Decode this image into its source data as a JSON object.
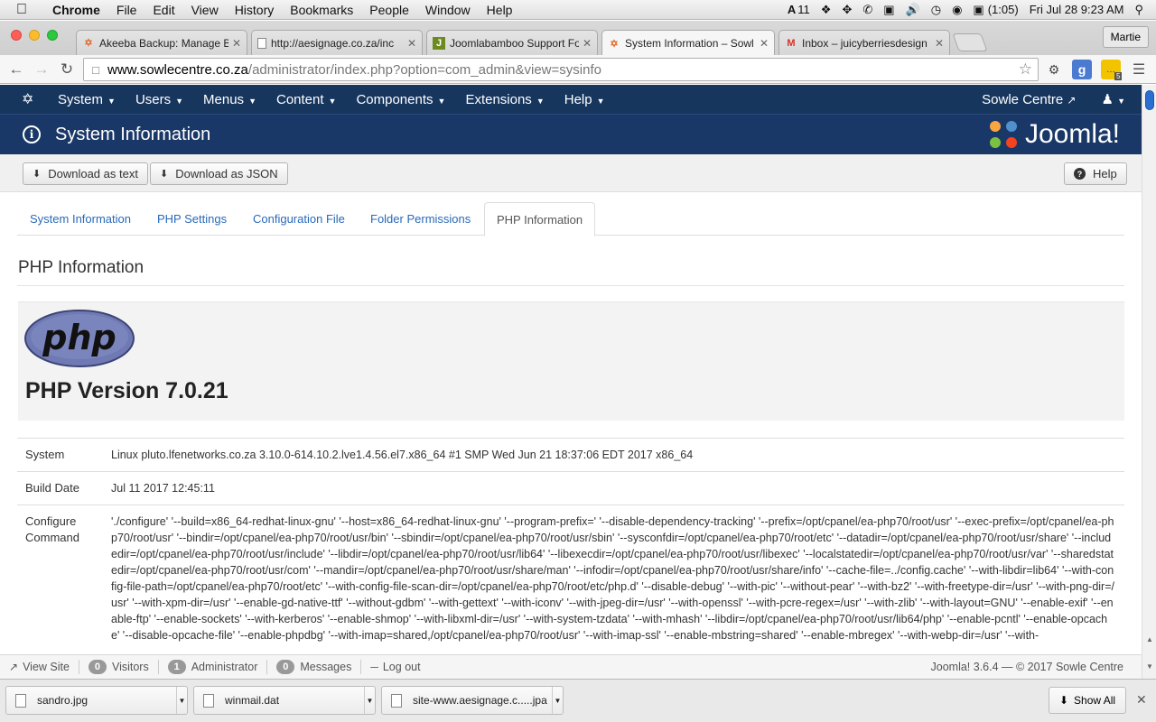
{
  "mac_menubar": {
    "app": "Chrome",
    "items": [
      "File",
      "Edit",
      "View",
      "History",
      "Bookmarks",
      "People",
      "Window",
      "Help"
    ],
    "status": {
      "adobe_count": "11",
      "battery": "(1:05)",
      "datetime": "Fri Jul 28  9:23 AM"
    }
  },
  "browser": {
    "tabs": [
      {
        "label": "Akeeba Backup: Manage Ba",
        "favicon": "joomla-favicon"
      },
      {
        "label": "http://aesignage.co.za/inc",
        "favicon": "page-favicon"
      },
      {
        "label": "Joomlabamboo Support Fo",
        "favicon": "joomlabamboo-favicon"
      },
      {
        "label": "System Information – Sowl",
        "favicon": "joomla-favicon"
      },
      {
        "label": "Inbox – juicyberriesdesign",
        "favicon": "gmail-favicon"
      }
    ],
    "profile": "Martie",
    "url_host": "www.sowlecentre.co.za",
    "url_path": "/administrator/index.php?option=com_admin&view=sysinfo",
    "ext_badge": "5"
  },
  "joomla": {
    "menu": [
      "System",
      "Users",
      "Menus",
      "Content",
      "Components",
      "Extensions",
      "Help"
    ],
    "site_link": "Sowle Centre",
    "page_title": "System Information",
    "brand": "Joomla!",
    "toolbar": {
      "download_text": "Download as text",
      "download_json": "Download as JSON",
      "help": "Help"
    },
    "tabs": [
      "System Information",
      "PHP Settings",
      "Configuration File",
      "Folder Permissions",
      "PHP Information"
    ],
    "active_tab": "PHP Information",
    "section_title": "PHP Information",
    "php_logo_text": "php",
    "php_version": "PHP Version 7.0.21",
    "info_rows": [
      {
        "key": "System",
        "value": "Linux pluto.lfenetworks.co.za 3.10.0-614.10.2.lve1.4.56.el7.x86_64 #1 SMP Wed Jun 21 18:37:06 EDT 2017 x86_64"
      },
      {
        "key": "Build Date",
        "value": "Jul 11 2017 12:45:11"
      },
      {
        "key": "Configure Command",
        "value": "'./configure' '--build=x86_64-redhat-linux-gnu' '--host=x86_64-redhat-linux-gnu' '--program-prefix=' '--disable-dependency-tracking' '--prefix=/opt/cpanel/ea-php70/root/usr' '--exec-prefix=/opt/cpanel/ea-php70/root/usr' '--bindir=/opt/cpanel/ea-php70/root/usr/bin' '--sbindir=/opt/cpanel/ea-php70/root/usr/sbin' '--sysconfdir=/opt/cpanel/ea-php70/root/etc' '--datadir=/opt/cpanel/ea-php70/root/usr/share' '--includedir=/opt/cpanel/ea-php70/root/usr/include' '--libdir=/opt/cpanel/ea-php70/root/usr/lib64' '--libexecdir=/opt/cpanel/ea-php70/root/usr/libexec' '--localstatedir=/opt/cpanel/ea-php70/root/usr/var' '--sharedstatedir=/opt/cpanel/ea-php70/root/usr/com' '--mandir=/opt/cpanel/ea-php70/root/usr/share/man' '--infodir=/opt/cpanel/ea-php70/root/usr/share/info' '--cache-file=../config.cache' '--with-libdir=lib64' '--with-config-file-path=/opt/cpanel/ea-php70/root/etc' '--with-config-file-scan-dir=/opt/cpanel/ea-php70/root/etc/php.d' '--disable-debug' '--with-pic' '--without-pear' '--with-bz2' '--with-freetype-dir=/usr' '--with-png-dir=/usr' '--with-xpm-dir=/usr' '--enable-gd-native-ttf' '--without-gdbm' '--with-gettext' '--with-iconv' '--with-jpeg-dir=/usr' '--with-openssl' '--with-pcre-regex=/usr' '--with-zlib' '--with-layout=GNU' '--enable-exif' '--enable-ftp' '--enable-sockets' '--with-kerberos' '--enable-shmop' '--with-libxml-dir=/usr' '--with-system-tzdata' '--with-mhash' '--libdir=/opt/cpanel/ea-php70/root/usr/lib64/php' '--enable-pcntl' '--enable-opcache' '--disable-opcache-file' '--enable-phpdbg' '--with-imap=shared,/opt/cpanel/ea-php70/root/usr' '--with-imap-ssl' '--enable-mbstring=shared' '--enable-mbregex' '--with-webp-dir=/usr' '--with-"
      }
    ],
    "status": {
      "view_site": "View Site",
      "visitors_count": "0",
      "visitors": "Visitors",
      "admin_count": "1",
      "admin": "Administrator",
      "messages_count": "0",
      "messages": "Messages",
      "logout": "Log out",
      "footer": "Joomla! 3.6.4  —  © 2017 Sowle Centre"
    }
  },
  "downloads": {
    "items": [
      "sandro.jpg",
      "winmail.dat",
      "site-www.aesignage.c.....jpa"
    ],
    "show_all": "Show All"
  },
  "colors": {
    "joomla_nav": "#17365e",
    "joomla_header": "#1a3867",
    "link_blue": "#2a69b8",
    "php_purple": "#6f79b3"
  }
}
